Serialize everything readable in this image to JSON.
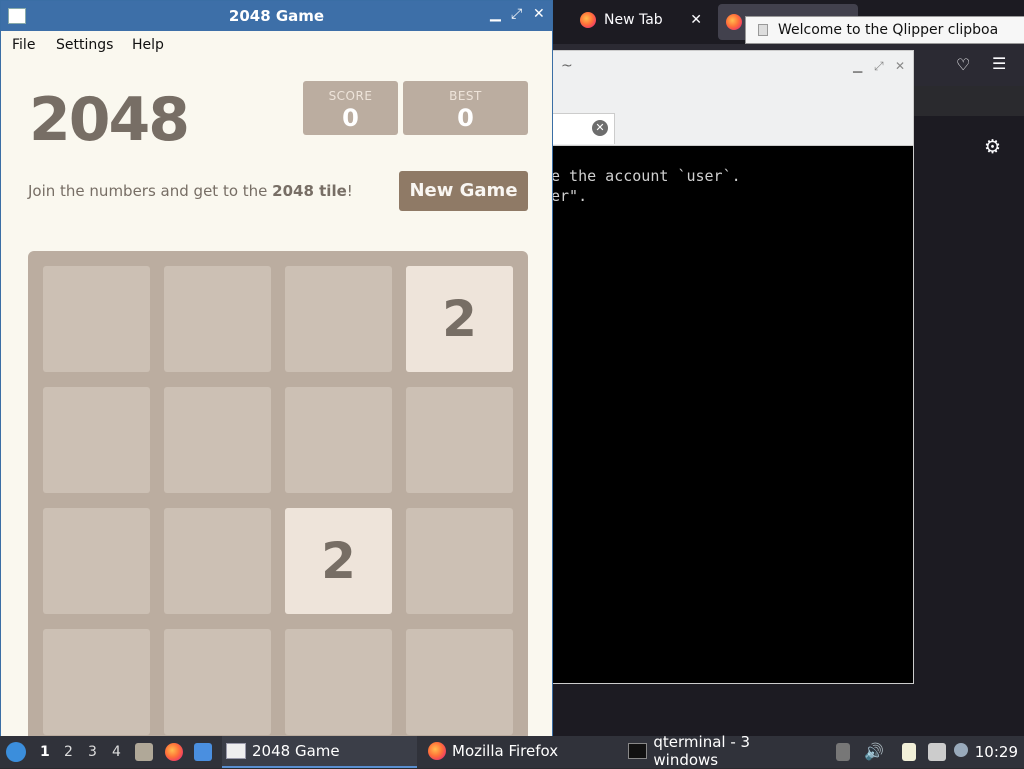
{
  "firefox": {
    "tab_newtab_label": "New Tab",
    "tab_close": "✕",
    "shield_icon": "♡",
    "menu_icon": "☰",
    "settings_icon": "⚙"
  },
  "qterminal": {
    "title": "~",
    "tab_close": "✕",
    "lines": [
      "e the account `user`.",
      "er\"."
    ]
  },
  "qlipper": {
    "message": "Welcome to the Qlipper clipboa"
  },
  "game": {
    "window_title": "2048 Game",
    "menu": {
      "file": "File",
      "settings": "Settings",
      "help": "Help"
    },
    "heading": "2048",
    "score_label": "SCORE",
    "score_value": "0",
    "best_label": "BEST",
    "best_value": "0",
    "intro_text": "Join the numbers and get to the ",
    "intro_bold": "2048 tile",
    "intro_end": "!",
    "new_game_label": "New Game",
    "board": [
      [
        "",
        "",
        "",
        "2"
      ],
      [
        "",
        "",
        "",
        ""
      ],
      [
        "",
        "",
        "2",
        ""
      ],
      [
        "",
        "",
        "",
        ""
      ]
    ]
  },
  "taskbar": {
    "desktops": [
      "1",
      "2",
      "3",
      "4"
    ],
    "tasks": {
      "game": "2048 Game",
      "firefox": "Mozilla Firefox",
      "qterminal": "qterminal - 3 windows"
    },
    "clock": "10:29"
  }
}
